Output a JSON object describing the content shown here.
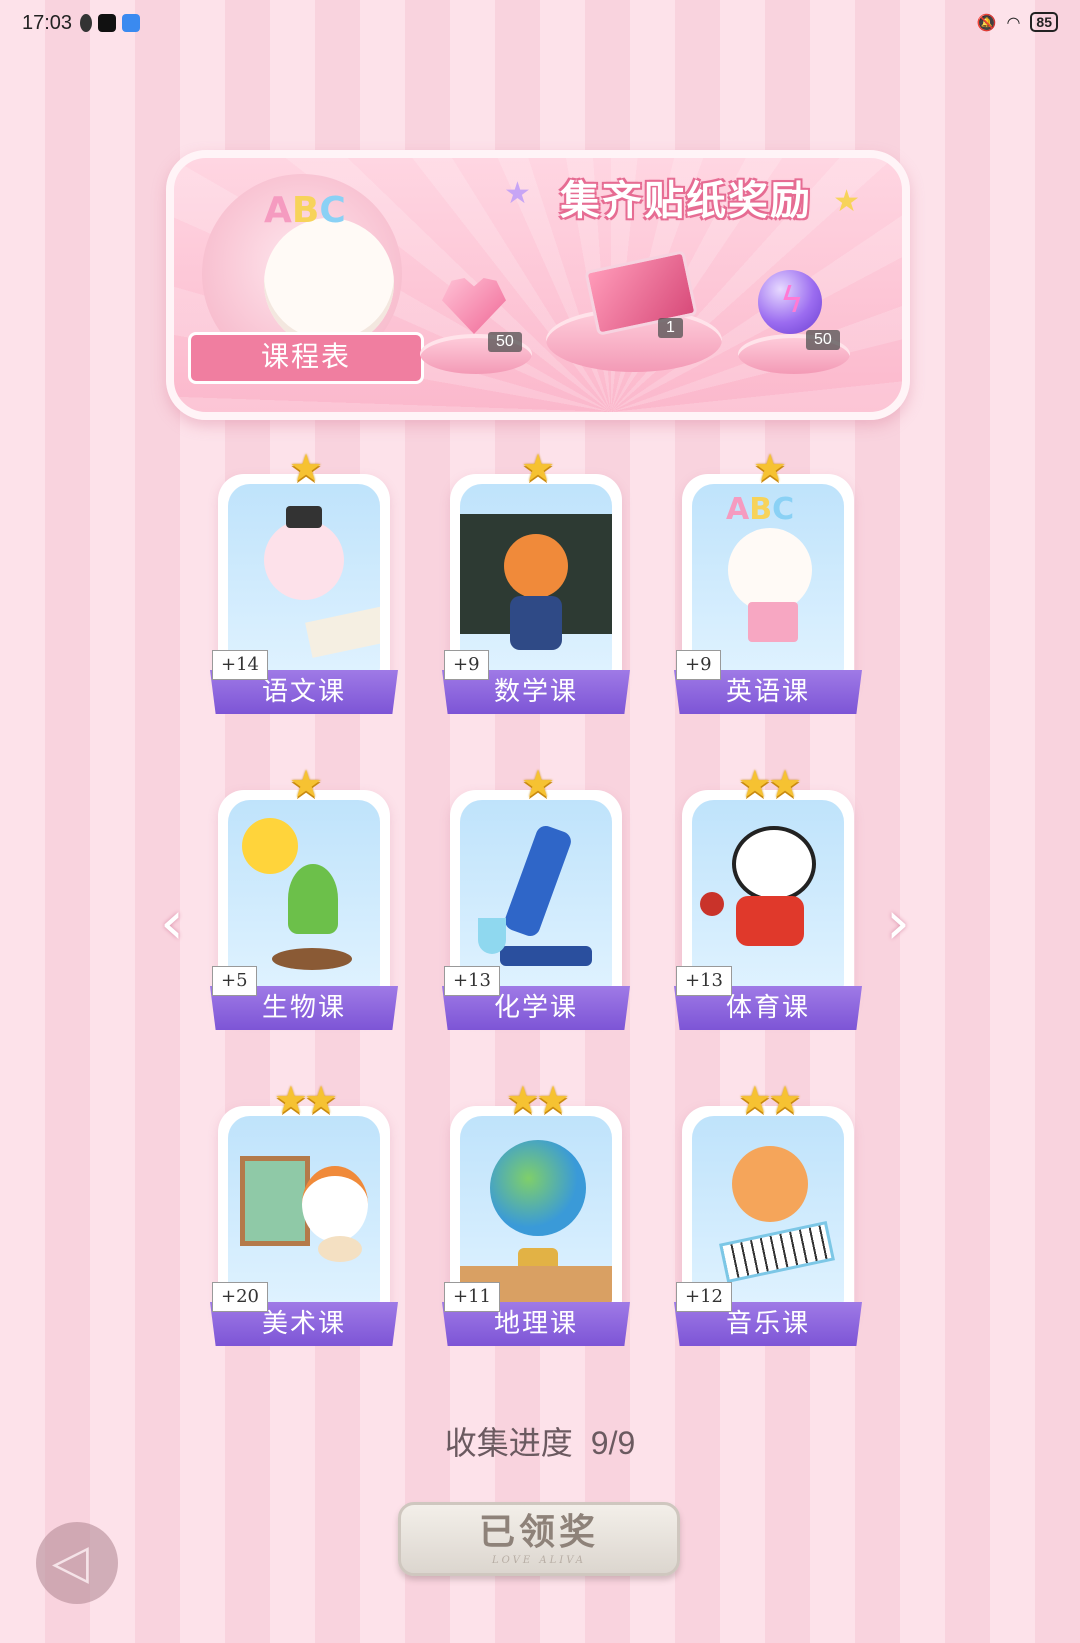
{
  "status_bar": {
    "time": "17:03",
    "battery": "85",
    "icons": [
      "qq-icon",
      "tiktok-icon",
      "cloud-app-icon",
      "mute-icon",
      "wifi-icon"
    ]
  },
  "banner": {
    "title": "集齐贴纸奖励",
    "schedule_label": "课程表",
    "abc": "ABC",
    "rewards": [
      {
        "icon": "heart-gem-icon",
        "count": "50"
      },
      {
        "icon": "gift-box-icon",
        "count": "1"
      },
      {
        "icon": "energy-orb-icon",
        "count": "50"
      }
    ]
  },
  "courses": [
    {
      "name": "语文课",
      "count": "+14",
      "stars": "★",
      "icon": "rabbit-calligraphy-icon"
    },
    {
      "name": "数学课",
      "count": "+9",
      "stars": "★",
      "icon": "fox-teacher-icon"
    },
    {
      "name": "英语课",
      "count": "+9",
      "stars": "★",
      "icon": "puppy-abc-icon"
    },
    {
      "name": "生物课",
      "count": "+5",
      "stars": "★",
      "icon": "sprout-sun-icon"
    },
    {
      "name": "化学课",
      "count": "+13",
      "stars": "★",
      "icon": "microscope-icon"
    },
    {
      "name": "体育课",
      "count": "+13",
      "stars": "★★",
      "icon": "panda-pingpong-icon"
    },
    {
      "name": "美术课",
      "count": "+20",
      "stars": "★★",
      "icon": "cat-painter-icon"
    },
    {
      "name": "地理课",
      "count": "+11",
      "stars": "★★",
      "icon": "globe-icon"
    },
    {
      "name": "音乐课",
      "count": "+12",
      "stars": "★★",
      "icon": "cat-keyboard-icon"
    }
  ],
  "progress": {
    "label": "收集进度",
    "value": "9/9"
  },
  "claim_button": {
    "label": "已领奖",
    "sub": "LOVE ALIVA"
  },
  "colors": {
    "accent_purple": "#8b63dc",
    "pink": "#f07ea0",
    "star_gold": "#f6c232"
  }
}
